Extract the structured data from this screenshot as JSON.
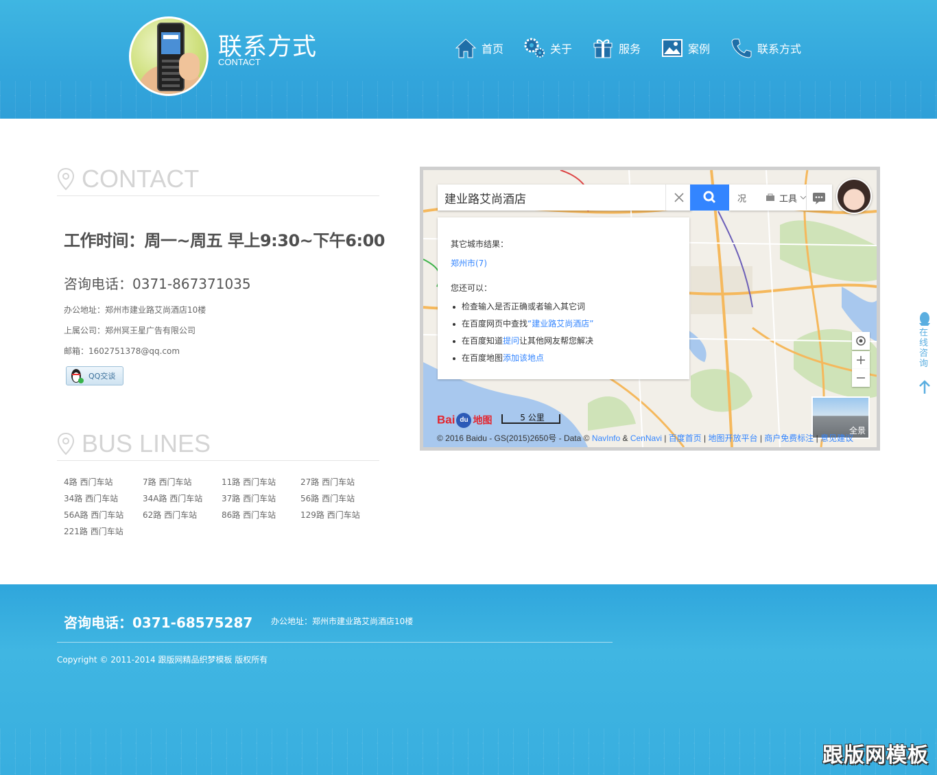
{
  "header": {
    "title": "联系方式",
    "subtitle": "CONTACT",
    "nav": [
      {
        "label": "首页",
        "icon": "home-icon"
      },
      {
        "label": "关于",
        "icon": "gears-icon"
      },
      {
        "label": "服务",
        "icon": "gift-icon"
      },
      {
        "label": "案例",
        "icon": "picture-icon"
      },
      {
        "label": "联系方式",
        "icon": "phone-icon"
      }
    ]
  },
  "contact": {
    "heading": "CONTACT",
    "hours": "工作时间：周一~周五 早上9:30~下午6:00",
    "tel": "咨询电话：0371-867371035",
    "address": "办公地址：郑州市建业路艾尚酒店10楼",
    "company": "上属公司：郑州冥王星广告有限公司",
    "email": "邮箱：1602751378@qq.com",
    "qq_label": "QQ交谈"
  },
  "bus": {
    "heading": "BUS LINES",
    "lines": [
      "4路 西门车站",
      "7路 西门车站",
      "11路 西门车站",
      "27路 西门车站",
      "34路 西门车站",
      "34A路 西门车站",
      "37路 西门车站",
      "56路 西门车站",
      "56A路 西门车站",
      "62路 西门车站",
      "86路 西门车站",
      "129路 西门车站",
      "221路 西门车站"
    ]
  },
  "map": {
    "search_value": "建业路艾尚酒店",
    "tools_label": "工具",
    "partial_label": "况",
    "other_results_title": "其它城市结果：",
    "city_link": "郑州市(7)",
    "suggest_title": "您还可以：",
    "tip1": "检查输入是否正确或者输入其它词",
    "tip2_prefix": "在百度网页中查找",
    "tip2_link": "“建业路艾尚酒店”",
    "tip3_prefix": "在百度知道",
    "tip3_link": "提问",
    "tip3_suffix": "让其他网友帮您解决",
    "tip4_prefix": "在百度地图",
    "tip4_link": "添加该地点",
    "scale_label": "5 公里",
    "pano_label": "全景",
    "logo_text_a": "Bai",
    "logo_text_b": "du",
    "logo_text_c": "地图",
    "copyright_text": "© 2016 Baidu - GS(2015)2650号 - Data © ",
    "link_navinfo": "NavInfo",
    "amp": " & ",
    "link_cennavi": "CenNavi",
    "link_home": "百度首页",
    "link_open": "地图开放平台",
    "link_merchant": "商户免费标注",
    "link_feedback": "意见建议",
    "sep": " | "
  },
  "side": {
    "label": "在线咨询"
  },
  "footer": {
    "tel": "咨询电话：0371-68575287",
    "address": "办公地址：郑州市建业路艾尚酒店10楼",
    "copyright": "Copyright © 2011-2014 跟版网精品织梦模板 版权所有",
    "watermark": "跟版网模板"
  },
  "colors": {
    "header_blue": "#3fb6e2",
    "map_blue": "#3385ff",
    "heading_gray": "#d4d4d4"
  }
}
